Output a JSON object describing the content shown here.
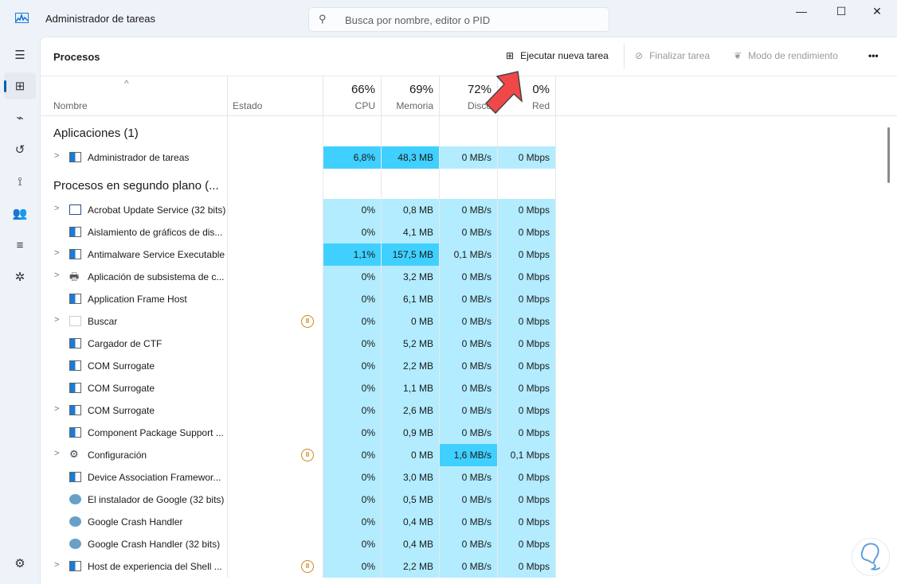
{
  "window": {
    "title": "Administrador de tareas",
    "search_placeholder": "Busca por nombre, editor o PID",
    "minimize": "—",
    "maximize": "☐",
    "close": "✕"
  },
  "toolbar": {
    "title": "Procesos",
    "run_new_task": "Ejecutar nueva tarea",
    "end_task": "Finalizar tarea",
    "efficiency_mode": "Modo de rendimiento",
    "more": "•••"
  },
  "columns": {
    "name": "Nombre",
    "status": "Estado",
    "cpu_pct": "66%",
    "cpu": "CPU",
    "mem_pct": "69%",
    "mem": "Memoria",
    "disk_pct": "72%",
    "disk": "Disco",
    "net_pct": "0%",
    "net": "Red"
  },
  "colors": {
    "heat_low": "#b3ecff",
    "heat_high": "#40d0ff",
    "accent": "#005fb8"
  },
  "groups": [
    {
      "label": "Aplicaciones (1)",
      "rows": [
        {
          "name": "Administrador de tareas",
          "icon": "taskmgr",
          "expand": true,
          "suspended": false,
          "cpu": "6,8%",
          "mem": "48,3 MB",
          "disk": "0 MB/s",
          "net": "0 Mbps",
          "hi": [
            "cpu",
            "mem"
          ]
        }
      ]
    },
    {
      "label": "Procesos en segundo plano (...",
      "rows": [
        {
          "name": "Acrobat Update Service (32 bits)",
          "icon": "window",
          "expand": true,
          "suspended": false,
          "cpu": "0%",
          "mem": "0,8 MB",
          "disk": "0 MB/s",
          "net": "0 Mbps",
          "hi": []
        },
        {
          "name": "Aislamiento de gráficos de dis...",
          "icon": "svc",
          "expand": false,
          "suspended": false,
          "cpu": "0%",
          "mem": "4,1 MB",
          "disk": "0 MB/s",
          "net": "0 Mbps",
          "hi": []
        },
        {
          "name": "Antimalware Service Executable",
          "icon": "svc",
          "expand": true,
          "suspended": false,
          "cpu": "1,1%",
          "mem": "157,5 MB",
          "disk": "0,1 MB/s",
          "net": "0 Mbps",
          "hi": [
            "cpu",
            "mem"
          ]
        },
        {
          "name": "Aplicación de subsistema de c...",
          "icon": "printer",
          "expand": true,
          "suspended": false,
          "cpu": "0%",
          "mem": "3,2 MB",
          "disk": "0 MB/s",
          "net": "0 Mbps",
          "hi": []
        },
        {
          "name": "Application Frame Host",
          "icon": "svc",
          "expand": false,
          "suspended": false,
          "cpu": "0%",
          "mem": "6,1 MB",
          "disk": "0 MB/s",
          "net": "0 Mbps",
          "hi": []
        },
        {
          "name": "Buscar",
          "icon": "none",
          "expand": true,
          "suspended": true,
          "cpu": "0%",
          "mem": "0 MB",
          "disk": "0 MB/s",
          "net": "0 Mbps",
          "hi": []
        },
        {
          "name": "Cargador de CTF",
          "icon": "svc",
          "expand": false,
          "suspended": false,
          "cpu": "0%",
          "mem": "5,2 MB",
          "disk": "0 MB/s",
          "net": "0 Mbps",
          "hi": []
        },
        {
          "name": "COM Surrogate",
          "icon": "svc",
          "expand": false,
          "suspended": false,
          "cpu": "0%",
          "mem": "2,2 MB",
          "disk": "0 MB/s",
          "net": "0 Mbps",
          "hi": []
        },
        {
          "name": "COM Surrogate",
          "icon": "svc",
          "expand": false,
          "suspended": false,
          "cpu": "0%",
          "mem": "1,1 MB",
          "disk": "0 MB/s",
          "net": "0 Mbps",
          "hi": []
        },
        {
          "name": "COM Surrogate",
          "icon": "svc",
          "expand": true,
          "suspended": false,
          "cpu": "0%",
          "mem": "2,6 MB",
          "disk": "0 MB/s",
          "net": "0 Mbps",
          "hi": []
        },
        {
          "name": "Component Package Support ...",
          "icon": "svc",
          "expand": false,
          "suspended": false,
          "cpu": "0%",
          "mem": "0,9 MB",
          "disk": "0 MB/s",
          "net": "0 Mbps",
          "hi": []
        },
        {
          "name": "Configuración",
          "icon": "gear",
          "expand": true,
          "suspended": true,
          "cpu": "0%",
          "mem": "0 MB",
          "disk": "1,6 MB/s",
          "net": "0,1 Mbps",
          "hi": [
            "disk"
          ]
        },
        {
          "name": "Device Association Framewor...",
          "icon": "svc",
          "expand": false,
          "suspended": false,
          "cpu": "0%",
          "mem": "3,0 MB",
          "disk": "0 MB/s",
          "net": "0 Mbps",
          "hi": []
        },
        {
          "name": "El instalador de Google (32 bits)",
          "icon": "google",
          "expand": false,
          "suspended": false,
          "cpu": "0%",
          "mem": "0,5 MB",
          "disk": "0 MB/s",
          "net": "0 Mbps",
          "hi": []
        },
        {
          "name": "Google Crash Handler",
          "icon": "google",
          "expand": false,
          "suspended": false,
          "cpu": "0%",
          "mem": "0,4 MB",
          "disk": "0 MB/s",
          "net": "0 Mbps",
          "hi": []
        },
        {
          "name": "Google Crash Handler (32 bits)",
          "icon": "google",
          "expand": false,
          "suspended": false,
          "cpu": "0%",
          "mem": "0,4 MB",
          "disk": "0 MB/s",
          "net": "0 Mbps",
          "hi": []
        },
        {
          "name": "Host de experiencia del Shell ...",
          "icon": "svc",
          "expand": true,
          "suspended": true,
          "cpu": "0%",
          "mem": "2,2 MB",
          "disk": "0 MB/s",
          "net": "0 Mbps",
          "hi": []
        }
      ]
    }
  ]
}
